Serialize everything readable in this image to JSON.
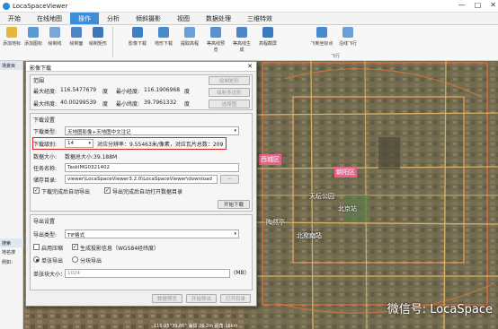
{
  "app": {
    "title": "LocaSpaceViewer",
    "window_buttons": [
      "—",
      "□",
      "✕"
    ]
  },
  "menu": [
    {
      "label": "开始",
      "active": false
    },
    {
      "label": "在线地图",
      "active": false
    },
    {
      "label": "操作",
      "active": true
    },
    {
      "label": "分析",
      "active": false
    },
    {
      "label": "倾斜摄影",
      "active": false
    },
    {
      "label": "视图",
      "active": false
    },
    {
      "label": "数据处理",
      "active": false
    },
    {
      "label": "三维特效",
      "active": false
    }
  ],
  "ribbon": {
    "buttons": [
      "添加地标",
      "添加图标",
      "绘制线",
      "绘制面",
      "绘制矩形",
      "影像下载",
      "地形下载",
      "提取高程",
      "等高线预览",
      "等高线生成",
      "高程截屏",
      "飞到坐标点",
      "沿线飞行"
    ],
    "group_fly": "飞行"
  },
  "left_panel": {
    "header": "场景目",
    "search_header": "搜索",
    "map_name_label": "地名搜",
    "example": "例如："
  },
  "dialog": {
    "title": "影像下载",
    "range_section": "范围",
    "max_lon_label": "最大经度:",
    "max_lon": "116.5477679",
    "deg1": "度",
    "min_lon_label": "最小经度:",
    "min_lon": "116.1906968",
    "deg2": "度",
    "max_lat_label": "最大纬度:",
    "max_lat": "40.00299539",
    "deg3": "度",
    "min_lat_label": "最小纬度:",
    "min_lat": "39.7961332",
    "deg4": "度",
    "btn_draw_rect": "绘制矩形",
    "btn_draw_poly": "绘制多边形",
    "btn_select_layer": "选择图",
    "download_section": "下载设置",
    "download_type_label": "下载类型:",
    "download_type": "天地图影像+天地图中文注记",
    "download_level_label": "下载级别:",
    "download_level": "14",
    "resolution_text": "对应分辨率：9.55463米/像素，对应瓦片总数：209",
    "data_size_label": "数据大小:",
    "data_size": "数据总大小:39.188M",
    "task_name_label": "任务名称:",
    "task_name": "TaskIMG0321402",
    "save_path_label": "储存目录:",
    "save_path": "viewer\\LocaSpaceViewer3.2.0\\LocaSpaceViewer\\download",
    "browse": "...",
    "auto_export_label": "下载完成后自动导出",
    "auto_open_label": "导出完成后自动打开数据目录",
    "btn_start": "开始下载",
    "export_section": "导出设置",
    "export_type_label": "导出类型:",
    "export_type": "TIF格式",
    "compress_label": "启用压缩",
    "geo_info_label": "生成投影信息（WGS84经纬度）",
    "single_export_label": "单张导出",
    "tile_export_label": "分块导出",
    "single_size_label": "单张块大小：",
    "single_size": "1024",
    "single_size_unit": "(MB)",
    "btn_preview": "数据预览",
    "btn_export": "开始导出",
    "btn_open_dir": "打开目录"
  },
  "map": {
    "places": [
      "天安门",
      "西城区",
      "朝阳区",
      "北京站",
      "天坛公园",
      "北京南站",
      "陶然亭"
    ],
    "watermark": "微信号: LocaSpace",
    "scale": "116.05°39.86° 海拔:26.2m 视角:16km"
  }
}
